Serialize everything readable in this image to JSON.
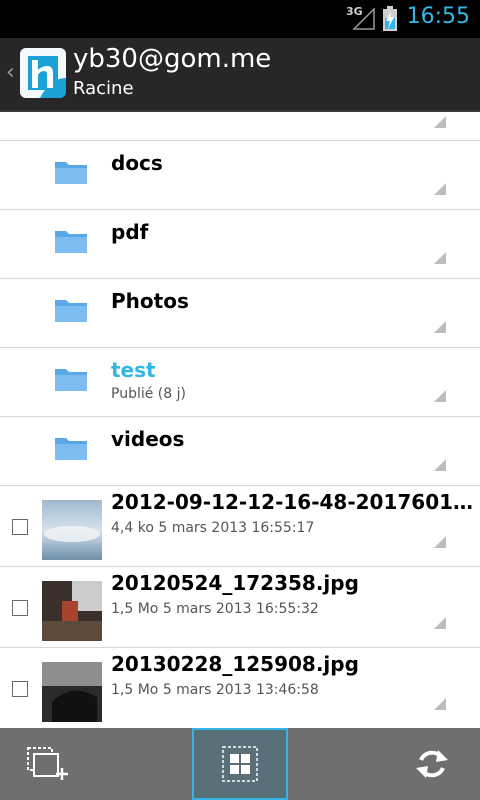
{
  "status_bar": {
    "network": "3G",
    "time": "16:55"
  },
  "header": {
    "account": "yb30@gom.me",
    "folder": "Racine",
    "logo_letter": "h"
  },
  "folders": [
    {
      "name": "docs",
      "detail": ""
    },
    {
      "name": "pdf",
      "detail": ""
    },
    {
      "name": "Photos",
      "detail": ""
    },
    {
      "name": "test",
      "detail": "Publié (8 j)"
    },
    {
      "name": "videos",
      "detail": ""
    }
  ],
  "files": [
    {
      "name": "2012-09-12-12-16-48-20176013...",
      "size": "4,4 ko",
      "date": "5 mars 2013 16:55:17"
    },
    {
      "name": "20120524_172358.jpg",
      "size": "1,5 Mo",
      "date": "5 mars 2013 16:55:32"
    },
    {
      "name": "20130228_125908.jpg",
      "size": "1,5 Mo",
      "date": "5 mars 2013 13:46:58"
    }
  ],
  "colors": {
    "accent": "#33b5e5",
    "folder": "#5aa7e8",
    "logo": "#1aa1d6"
  },
  "icons": {
    "back": "chevron-left-icon",
    "folder": "folder-icon",
    "select_multiple": "add-selection-icon",
    "grid_view": "grid-icon",
    "refresh": "refresh-icon"
  }
}
